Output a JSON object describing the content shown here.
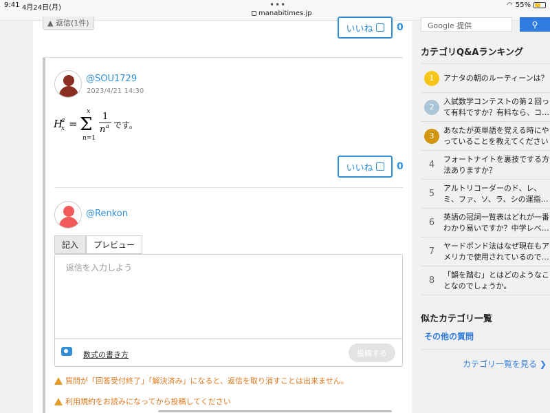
{
  "status": {
    "time": "9:41",
    "date": "4月24日(月)",
    "url": "manabitimes.jp",
    "battery": "55%"
  },
  "replies_toggle": "▲ 返信(1件)",
  "like_label": "いいね",
  "top_like_count": "0",
  "comment": {
    "user": "@SOU1729",
    "timestamp": "2023/4/21 14:30",
    "formula_suffix": "です。",
    "like_count": "0"
  },
  "composer": {
    "user": "@Renkon",
    "tabs": [
      "記入",
      "プレビュー"
    ],
    "placeholder": "返信を入力しよう",
    "formula_help": "数式の書き方",
    "post_button": "投稿する"
  },
  "warnings": [
    "質問が「回答受付終了」「解決済み」になると、返信を取り消すことは出来ません。",
    "利用規約をお読みになってから投稿してください"
  ],
  "sidebar": {
    "search_placeholder": "Google 提供",
    "ranking_title": "カテゴリQ&Aランキング",
    "ranking": [
      {
        "rank": "1",
        "lines": [
          "アナタの朝のルーティーンは？"
        ],
        "color": "#f5c518"
      },
      {
        "rank": "2",
        "lines": [
          "入試数学コンテストの第２回っ",
          "て有料ですか？有料なら、コ…"
        ],
        "color": "#aac4d8"
      },
      {
        "rank": "3",
        "lines": [
          "あなたが英単語を覚える時にや",
          "っていることを教えてください"
        ],
        "color": "#d4950f"
      },
      {
        "rank": "4",
        "lines": [
          "フォートナイトを裏技でする方",
          "法ありますか？"
        ],
        "color": ""
      },
      {
        "rank": "5",
        "lines": [
          "アルトリコーダーのド、レ、",
          "ミ、ファ、ソ、ラ、シの運指…"
        ],
        "color": ""
      },
      {
        "rank": "6",
        "lines": [
          "英語の冠詞一覧表はどれが一番",
          "わかり易いですか？中学レベ…"
        ],
        "color": ""
      },
      {
        "rank": "7",
        "lines": [
          "ヤードポンド法はなぜ現在もア",
          "メリカで使用されているので…"
        ],
        "color": ""
      },
      {
        "rank": "8",
        "lines": [
          "「韻を踏む」とはどのようなこ",
          "となのでしょうか。"
        ],
        "color": ""
      }
    ],
    "similar_title": "似たカテゴリ一覧",
    "similar_link": "その他の質問",
    "all_categories": "カテゴリ一覧を見る"
  }
}
